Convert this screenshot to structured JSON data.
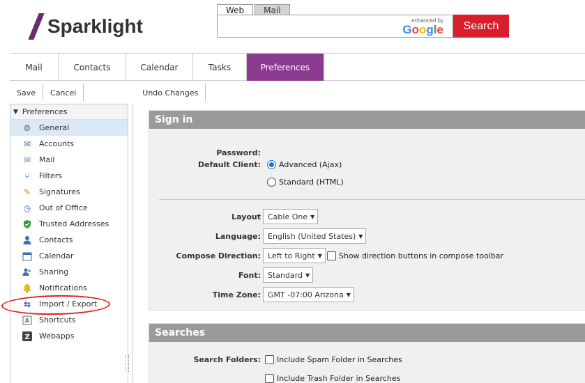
{
  "header": {
    "logo_text": "Sparklight",
    "search_tabs": [
      "Web",
      "Mail"
    ],
    "enhanced_by": "enhanced by",
    "google": "Google",
    "search_button": "Search"
  },
  "main_tabs": [
    "Mail",
    "Contacts",
    "Calendar",
    "Tasks",
    "Preferences"
  ],
  "toolbar": {
    "save": "Save",
    "cancel": "Cancel",
    "undo": "Undo Changes"
  },
  "sidebar": {
    "title": "Preferences",
    "items": [
      {
        "label": "General",
        "icon": "gear-icon"
      },
      {
        "label": "Accounts",
        "icon": "accounts-icon"
      },
      {
        "label": "Mail",
        "icon": "mail-icon"
      },
      {
        "label": "Filters",
        "icon": "filter-icon"
      },
      {
        "label": "Signatures",
        "icon": "signature-icon"
      },
      {
        "label": "Out of Office",
        "icon": "out-of-office-icon"
      },
      {
        "label": "Trusted Addresses",
        "icon": "shield-icon"
      },
      {
        "label": "Contacts",
        "icon": "contacts-icon"
      },
      {
        "label": "Calendar",
        "icon": "calendar-icon"
      },
      {
        "label": "Sharing",
        "icon": "sharing-icon"
      },
      {
        "label": "Notifications",
        "icon": "bell-icon"
      },
      {
        "label": "Import / Export",
        "icon": "import-export-icon"
      },
      {
        "label": "Shortcuts",
        "icon": "shortcuts-icon"
      },
      {
        "label": "Webapps",
        "icon": "webapps-icon"
      }
    ]
  },
  "signin": {
    "title": "Sign in",
    "password_label": "Password:",
    "default_client_label": "Default Client:",
    "client_advanced": "Advanced (Ajax)",
    "client_standard": "Standard (HTML)",
    "layout_label": "Layout",
    "layout_value": "Cable One",
    "language_label": "Language:",
    "language_value": "English (United States)",
    "compose_label": "Compose Direction:",
    "compose_value": "Left to Right",
    "compose_check": "Show direction buttons in compose toolbar",
    "font_label": "Font:",
    "font_value": "Standard",
    "timezone_label": "Time Zone:",
    "timezone_value": "GMT -07:00 Arizona"
  },
  "searches": {
    "title": "Searches",
    "folders_label": "Search Folders:",
    "spam": "Include Spam Folder in Searches",
    "trash": "Include Trash Folder in Searches"
  },
  "colors": {
    "brand": "#6b2c6f",
    "active_tab": "#8b3b8f",
    "search_button": "#d81e2c",
    "annotation": "#e02020"
  }
}
